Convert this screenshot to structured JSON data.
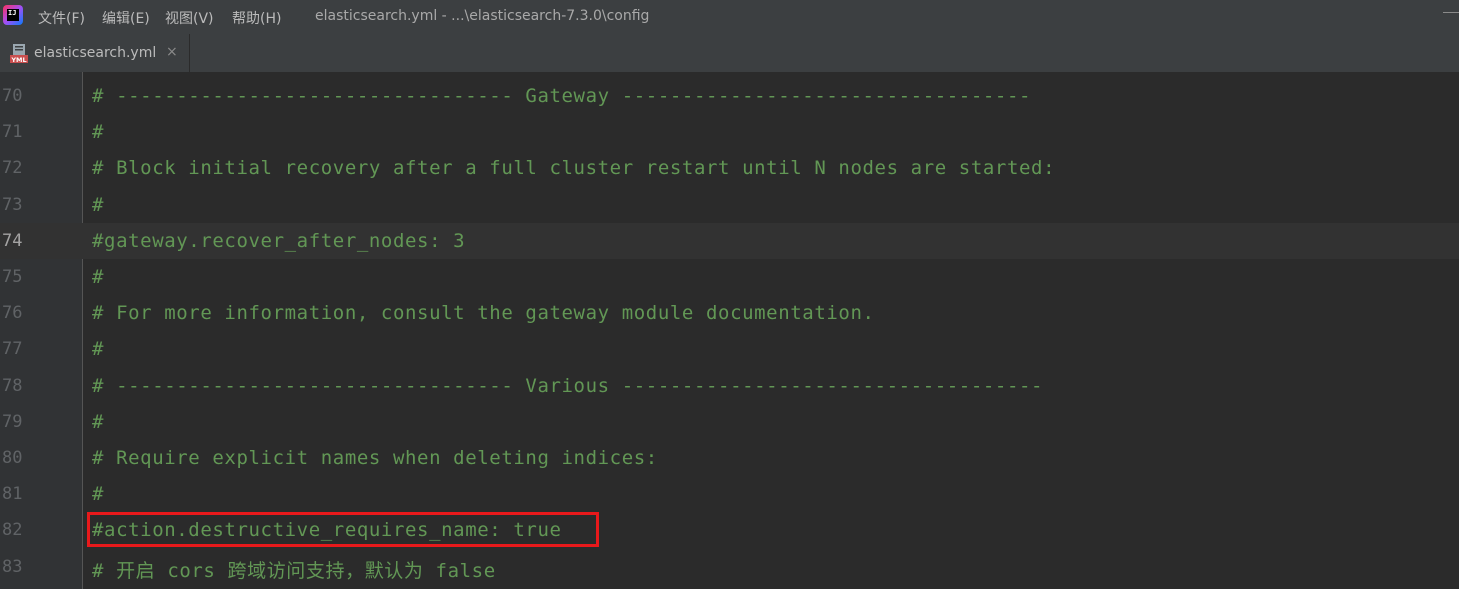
{
  "titlebar": {
    "menus": [
      "文件(F)",
      "编辑(E)",
      "视图(V)",
      "帮助(H)"
    ],
    "title": "elasticsearch.yml - ...\\elasticsearch-7.3.0\\config"
  },
  "tab": {
    "label": "elasticsearch.yml",
    "close": "×",
    "icon_text": "YML"
  },
  "editor": {
    "current_line": 74,
    "highlight_color": "#e8191b",
    "comment_color": "#629755",
    "lines": [
      {
        "num": "70",
        "text": "# --------------------------------- Gateway ----------------------------------"
      },
      {
        "num": "71",
        "text": "#"
      },
      {
        "num": "72",
        "text": "# Block initial recovery after a full cluster restart until N nodes are started:"
      },
      {
        "num": "73",
        "text": "#"
      },
      {
        "num": "74",
        "text": "#gateway.recover_after_nodes: 3"
      },
      {
        "num": "75",
        "text": "#"
      },
      {
        "num": "76",
        "text": "# For more information, consult the gateway module documentation."
      },
      {
        "num": "77",
        "text": "#"
      },
      {
        "num": "78",
        "text": "# --------------------------------- Various -----------------------------------"
      },
      {
        "num": "79",
        "text": "#"
      },
      {
        "num": "80",
        "text": "# Require explicit names when deleting indices:"
      },
      {
        "num": "81",
        "text": "#"
      },
      {
        "num": "82",
        "text": "#action.destructive_requires_name: true"
      },
      {
        "num": "83",
        "text": "# 开启 cors 跨域访问支持，默认为 false"
      }
    ]
  }
}
